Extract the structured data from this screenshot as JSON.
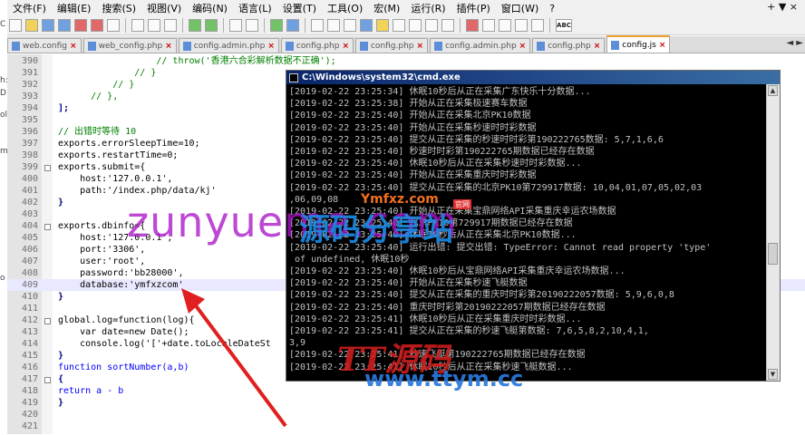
{
  "menu": [
    "文件(F)",
    "编辑(E)",
    "搜索(S)",
    "视图(V)",
    "编码(N)",
    "语言(L)",
    "设置(T)",
    "工具(O)",
    "宏(M)",
    "运行(R)",
    "插件(P)",
    "窗口(W)",
    "?"
  ],
  "window_controls": "+ ▼ ×",
  "tabs": [
    {
      "label": "web.config",
      "active": false
    },
    {
      "label": "web_config.php",
      "active": false
    },
    {
      "label": "config.admin.php",
      "active": false
    },
    {
      "label": "config.php",
      "active": false
    },
    {
      "label": "config.php",
      "active": false
    },
    {
      "label": "config.admin.php",
      "active": false
    },
    {
      "label": "config.php",
      "active": false
    },
    {
      "label": "config.js",
      "active": true
    }
  ],
  "tab_scroll": "◄ ►",
  "left_strip_chars": [
    "C",
    "h:",
    "D",
    "ol",
    "m",
    "o"
  ],
  "editor_lines": [
    {
      "n": "390",
      "text": "                  // throw('香港六合彩解析数据不正确');"
    },
    {
      "n": "391",
      "text": "              // }"
    },
    {
      "n": "392",
      "text": "          // }"
    },
    {
      "n": "393",
      "text": "      // },"
    },
    {
      "n": "394",
      "text": "];"
    },
    {
      "n": "395",
      "text": ""
    },
    {
      "n": "396",
      "text": "// 出错时等待 10"
    },
    {
      "n": "397",
      "text": "exports.errorSleepTime=10;"
    },
    {
      "n": "398",
      "text": "exports.restartTime=0;"
    },
    {
      "n": "399",
      "text": "exports.submit={"
    },
    {
      "n": "400",
      "text": "    host:'127.0.0.1',"
    },
    {
      "n": "401",
      "text": "    path:'/index.php/data/kj'"
    },
    {
      "n": "402",
      "text": "}"
    },
    {
      "n": "403",
      "text": ""
    },
    {
      "n": "404",
      "text": "exports.dbinfo={"
    },
    {
      "n": "405",
      "text": "    host:'127.0.0.1',"
    },
    {
      "n": "406",
      "text": "    port:'3306',"
    },
    {
      "n": "407",
      "text": "    user:'root',"
    },
    {
      "n": "408",
      "text": "    password:'bb28000',"
    },
    {
      "n": "409",
      "text": "    database:'ymfxzcom'"
    },
    {
      "n": "410",
      "text": "}"
    },
    {
      "n": "411",
      "text": ""
    },
    {
      "n": "412",
      "text": "global.log=function(log){"
    },
    {
      "n": "413",
      "text": "    var date=new Date();"
    },
    {
      "n": "414",
      "text": "    console.log('['+date.toLocaleDateSt"
    },
    {
      "n": "415",
      "text": "}"
    },
    {
      "n": "416",
      "text": "function sortNumber(a,b)"
    },
    {
      "n": "417",
      "text": "{"
    },
    {
      "n": "418",
      "text": "return a - b"
    },
    {
      "n": "419",
      "text": "}"
    },
    {
      "n": "420",
      "text": ""
    },
    {
      "n": "421",
      "text": ""
    }
  ],
  "cmd": {
    "title": "C:\\Windows\\system32\\cmd.exe",
    "lines": [
      "[2019-02-22 23:25:34] 休眠10秒后从正在采集广东快乐十分数据...",
      "[2019-02-22 23:25:38] 开始从正在采集极速赛车数据",
      "[2019-02-22 23:25:40] 开始从正在采集北京PK10数据",
      "[2019-02-22 23:25:40] 开始从正在采集秒速时时彩数据",
      "[2019-02-22 23:25:40] 提交从正在采集的秒速时时彩第190222765数据: 5,7,1,6,6",
      "[2019-02-22 23:25:40] 秒速时时彩第190222765期数据已经存在数据",
      "[2019-02-22 23:25:40] 休眠10秒后从正在采集秒速时时彩数据...",
      "[2019-02-22 23:25:40] 开始从正在采集重庆时时彩数据",
      "[2019-02-22 23:25:40] 提交从正在采集的北京PK10第729917数据: 10,04,01,07,05,02,03",
      ",06,09,08",
      "[2019-02-22 23:25:40] 开始从正在采集宝鼎网络API采集重庆幸运农场数据",
      "[2019-02-22 23:25:40] 北京PK10第729917期数据已经存在数据",
      "[2019-02-22 23:25:40] 休眠10秒后从正在采集北京PK10数据...",
      "[2019-02-22 23:25:40] 运行出错: 提交出错: TypeError: Cannot read property 'type'",
      " of undefined, 休眠10秒",
      "[2019-02-22 23:25:40] 休眠10秒后从宝鼎网络API采集重庆幸运农场数据...",
      "[2019-02-22 23:25:40] 开始从正在采集秒速飞艇数据",
      "[2019-02-22 23:25:40] 提交从正在采集的重庆时时彩第20190222057数据: 5,9,6,0,8",
      "[2019-02-22 23:25:40] 重庆时时彩第20190222057期数据已经存在数据",
      "[2019-02-22 23:25:41] 休眠10秒后从正在采集重庆时时彩数据...",
      "[2019-02-22 23:25:41] 提交从正在采集的秒速飞艇第数据: 7,6,5,8,2,10,4,1,",
      "3,9",
      "[2019-02-22 23:25:41] 秒速飞艇第190222765期数据已经存在数据",
      "[2019-02-22 23:25:41] 休眠10秒后从正在采集秒速飞艇数据..."
    ]
  },
  "watermarks": {
    "big": "zunyuema.com",
    "logo": "源码分享站",
    "small": "Ymfxz.com",
    "badge": "官网",
    "ttym": "TT源码",
    "url": "www.ttym.cc"
  }
}
